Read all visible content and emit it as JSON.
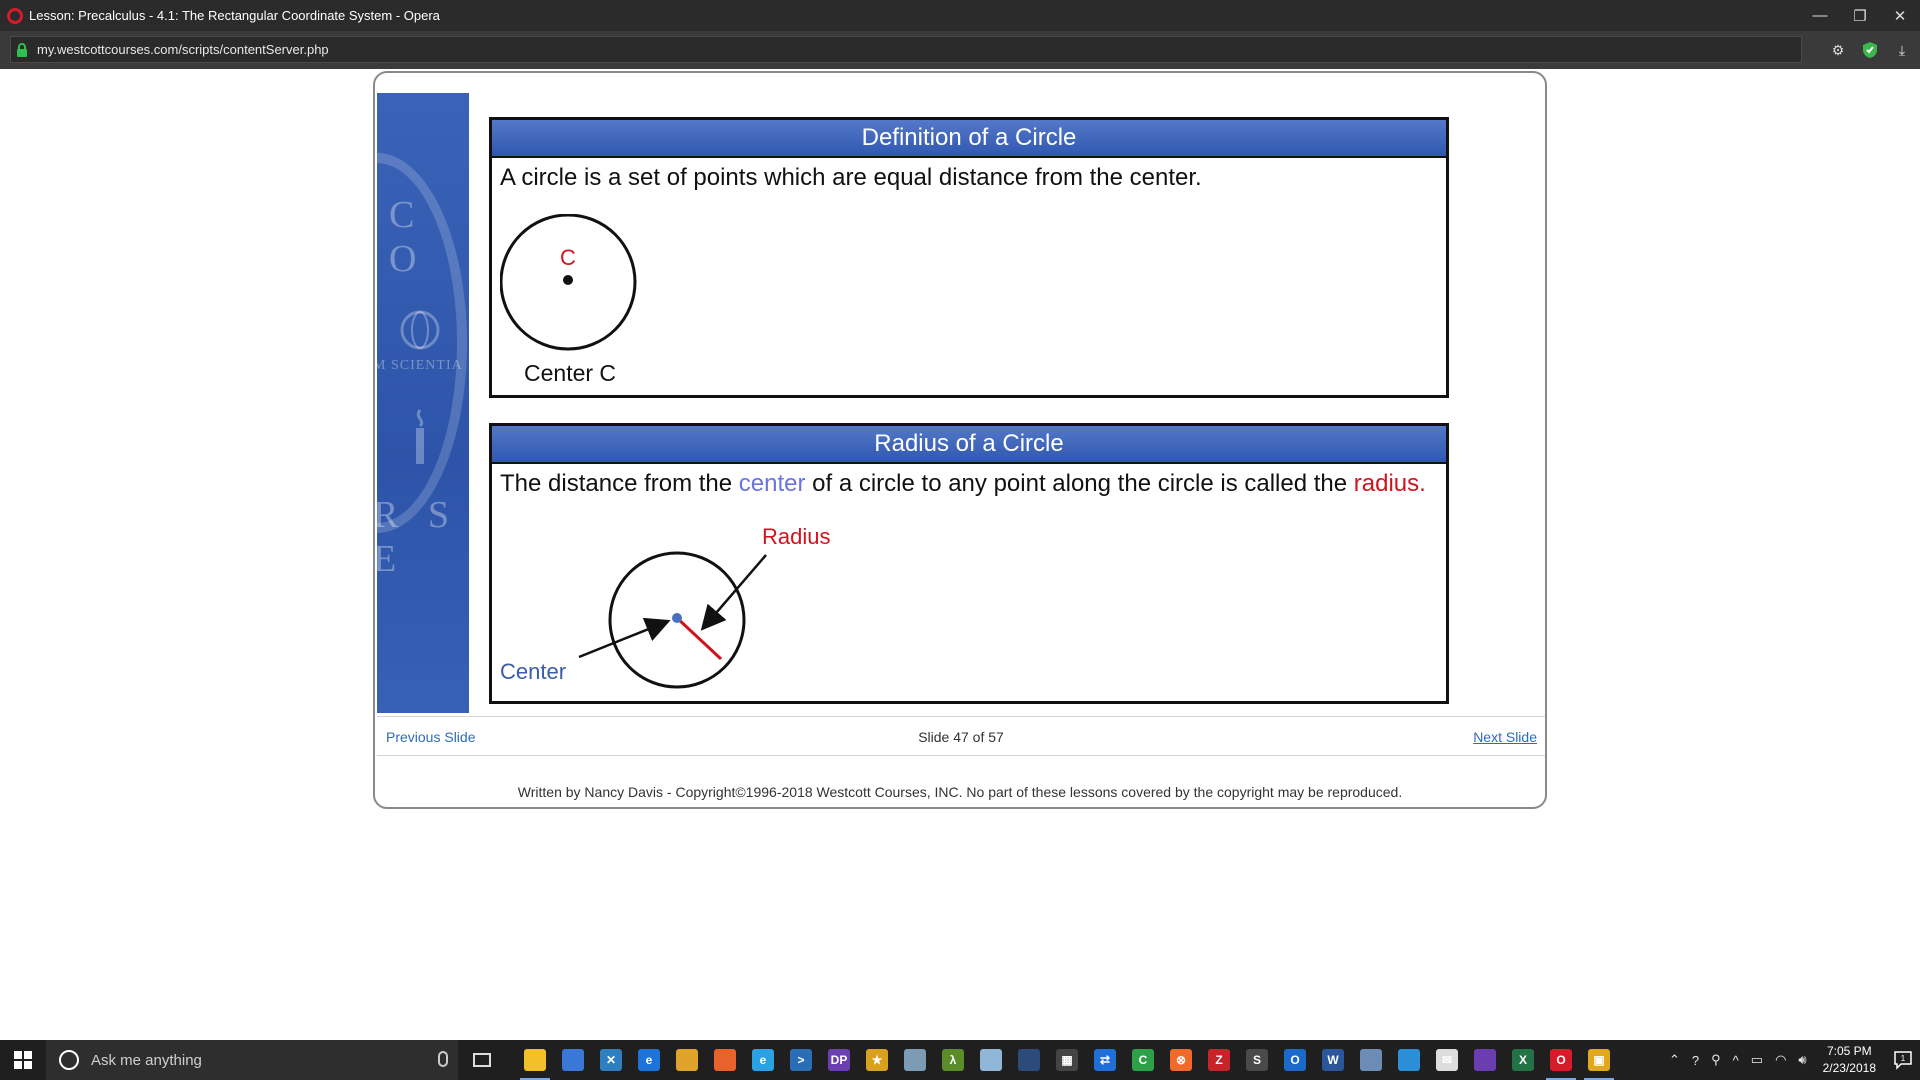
{
  "window": {
    "title": "Lesson: Precalculus - 4.1: The Rectangular Coordinate System - Opera",
    "minimize": "—",
    "restore": "❐",
    "close": "✕"
  },
  "addressbar": {
    "url": "my.westcottcourses.com/scripts/contentServer.php"
  },
  "slide": {
    "seal_text_1": "C O",
    "seal_text_2": "M SCIENTIA",
    "seal_text_3": "R S E",
    "panel1": {
      "heading": "Definition of a Circle",
      "text": "A circle is a set of points which are equal distance from the center.",
      "point_label": "C",
      "caption": "Center C"
    },
    "panel2": {
      "heading": "Radius of a Circle",
      "text_part1": "The distance from the ",
      "text_center": "center",
      "text_part2": " of a circle to any point along the circle is called the ",
      "text_radius": "radius.",
      "radius_label": "Radius",
      "center_label": "Center"
    }
  },
  "navigation": {
    "previous": "Previous Slide",
    "counter": "Slide 47 of 57",
    "next": "Next Slide"
  },
  "footer": {
    "copyright": "Written by Nancy Davis - Copyright©1996-2018 Westcott Courses, INC. No part of these lessons covered by the copyright may be reproduced."
  },
  "taskbar": {
    "search_placeholder": "Ask me anything",
    "time": "7:05 PM",
    "date": "2/23/2018",
    "notification_count": "1",
    "apps": [
      {
        "name": "file-explorer-icon",
        "color": "#f2c029",
        "glyph": ""
      },
      {
        "name": "store-icon",
        "color": "#3a78d8",
        "glyph": ""
      },
      {
        "name": "vs-code-icon",
        "color": "#2d7fc1",
        "glyph": "✕"
      },
      {
        "name": "edge-icon",
        "color": "#1e73d8",
        "glyph": "e"
      },
      {
        "name": "chrome-icon",
        "color": "#e0a32a",
        "glyph": ""
      },
      {
        "name": "firefox-icon",
        "color": "#e8622c",
        "glyph": ""
      },
      {
        "name": "ie-icon",
        "color": "#2aa1e0",
        "glyph": "e"
      },
      {
        "name": "powershell-icon",
        "color": "#2a6fb5",
        "glyph": ">"
      },
      {
        "name": "dp-icon",
        "color": "#6b3fb0",
        "glyph": "DP"
      },
      {
        "name": "star-icon",
        "color": "#d8a21f",
        "glyph": "★"
      },
      {
        "name": "satellite-icon",
        "color": "#7c9bb5",
        "glyph": ""
      },
      {
        "name": "lambda-icon",
        "color": "#5a8c2a",
        "glyph": "λ"
      },
      {
        "name": "paper-icon",
        "color": "#8fb6d6",
        "glyph": ""
      },
      {
        "name": "media-icon",
        "color": "#2b4b7a",
        "glyph": ""
      },
      {
        "name": "calculator-icon",
        "color": "#444444",
        "glyph": "▦"
      },
      {
        "name": "teamviewer-icon",
        "color": "#1e6fd8",
        "glyph": "⇄"
      },
      {
        "name": "camtasia-icon",
        "color": "#2fa04a",
        "glyph": "C"
      },
      {
        "name": "xampp-icon",
        "color": "#f26a2a",
        "glyph": "⊗"
      },
      {
        "name": "filezilla-icon",
        "color": "#c7232a",
        "glyph": "Z"
      },
      {
        "name": "sublime-icon",
        "color": "#4a4a4a",
        "glyph": "S"
      },
      {
        "name": "outlook-icon",
        "color": "#1b6ac9",
        "glyph": "O"
      },
      {
        "name": "word-icon",
        "color": "#2b579a",
        "glyph": "W"
      },
      {
        "name": "network-icon",
        "color": "#6a8cb5",
        "glyph": ""
      },
      {
        "name": "remote-desktop-icon",
        "color": "#2a8fd6",
        "glyph": ""
      },
      {
        "name": "mail-icon",
        "color": "#dddddd",
        "glyph": "✉"
      },
      {
        "name": "visual-studio-icon",
        "color": "#6a3eb0",
        "glyph": ""
      },
      {
        "name": "excel-icon",
        "color": "#217346",
        "glyph": "X"
      },
      {
        "name": "opera-taskbar-icon",
        "color": "#d81b2a",
        "glyph": "O"
      },
      {
        "name": "slides-icon",
        "color": "#e0a81a",
        "glyph": "▣"
      }
    ]
  }
}
